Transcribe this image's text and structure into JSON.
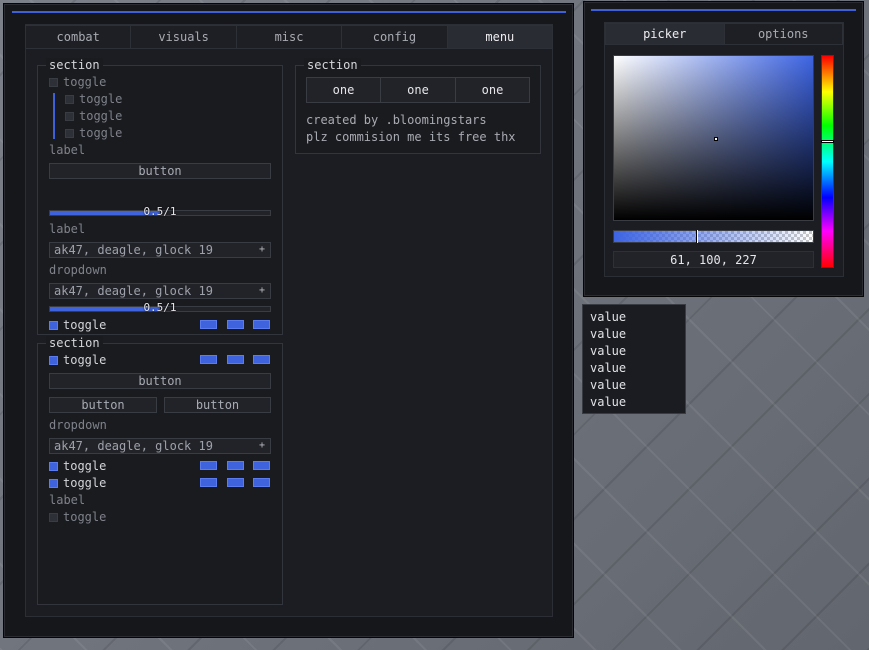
{
  "main": {
    "tabs": [
      {
        "label": "combat",
        "active": false
      },
      {
        "label": "visuals",
        "active": false
      },
      {
        "label": "misc",
        "active": false
      },
      {
        "label": "config",
        "active": false
      },
      {
        "label": "menu",
        "active": true
      }
    ],
    "section1": {
      "title": "section",
      "toggle_main": "toggle",
      "sub_toggles": [
        "toggle",
        "toggle",
        "toggle"
      ],
      "label1": "label",
      "button": "button",
      "slider1": {
        "value": 0.5,
        "max": 1,
        "text": "0.5/1"
      },
      "label2": "label",
      "dropdown1": "ak47, deagle, glock 19",
      "dropdown_label": "dropdown",
      "dropdown2": "ak47, deagle, glock 19",
      "slider2": {
        "value": 0.5,
        "max": 1,
        "text": "0.5/1"
      },
      "toggle_colors": "toggle"
    },
    "section2": {
      "title": "section",
      "toggle1": "toggle",
      "button_full": "button",
      "button_left": "button",
      "button_right": "button",
      "dropdown_label": "dropdown",
      "dropdown": "ak47, deagle, glock 19",
      "toggle2": "toggle",
      "toggle3": "toggle",
      "label": "label",
      "toggle4": "toggle"
    },
    "section3": {
      "title": "section",
      "buttons": [
        "one",
        "one",
        "one"
      ],
      "credit_line1": "created by .bloomingstars",
      "credit_line2": "plz commision me its free thx"
    }
  },
  "picker": {
    "tabs": [
      {
        "label": "picker",
        "active": true
      },
      {
        "label": "options",
        "active": false
      }
    ],
    "rgb_text": "61, 100, 227",
    "color": "#3d64e3"
  },
  "value_list": [
    "value",
    "value",
    "value",
    "value",
    "value",
    "value"
  ],
  "colors": {
    "accent": "#3f60d8",
    "checkbox_on": "#3f63dc",
    "window_bg": "#16171b"
  }
}
